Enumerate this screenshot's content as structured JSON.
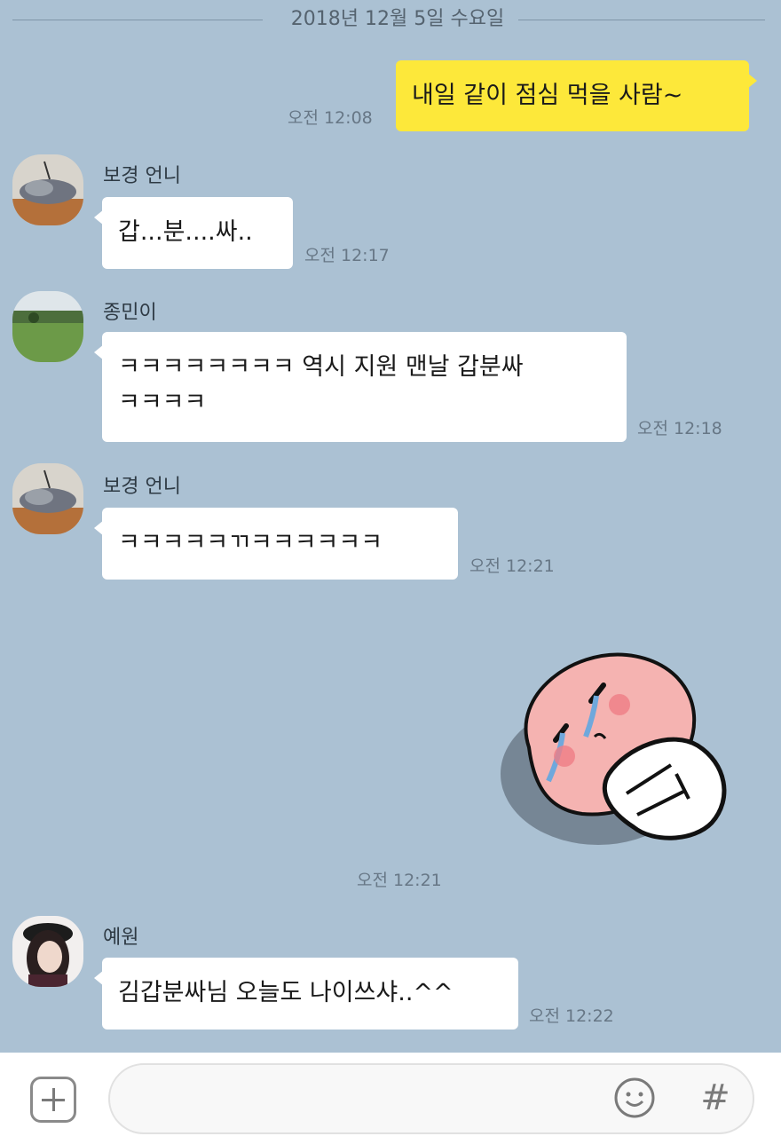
{
  "date_divider": "2018년 12월 5일 수요일",
  "messages": [
    {
      "sender": "",
      "text": "내일 같이 점심 먹을 사람~",
      "time": "오전 12:08"
    },
    {
      "sender": "보경 언니",
      "text": "갑...분....싸..",
      "time": "오전 12:17"
    },
    {
      "sender": "종민이",
      "lines": [
        "ㅋㅋㅋㅋㅋㅋㅋㅋ 역시 지원 맨날 갑분싸",
        "ㅋㅋㅋㅋ"
      ],
      "time": "오전 12:18"
    },
    {
      "sender": "보경 언니",
      "text": "ㅋㅋㅋㅋㅋㄲㅋㅋㅋㅋㅋㅋ",
      "time": "오전 12:21"
    },
    {
      "sender": "",
      "sticker": "crying-peach-sticker",
      "time": "오전 12:21"
    },
    {
      "sender": "예원",
      "text": "김갑분싸님 오늘도 나이쓰샤..^^",
      "time": "오전 12:22"
    }
  ],
  "input_bar": {
    "placeholder": "",
    "plus_icon": "plus-icon",
    "emoji_icon": "smiley-icon",
    "hash_label": "#"
  },
  "colors": {
    "background": "#abc1d3",
    "my_bubble": "#fde83a",
    "their_bubble": "#ffffff"
  }
}
